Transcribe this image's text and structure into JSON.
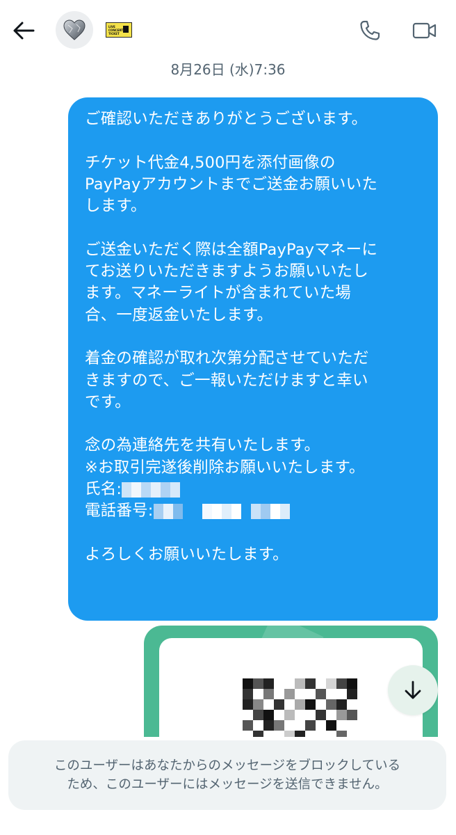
{
  "header": {
    "back_icon": "arrow-left-icon",
    "avatar_icon": "heart-icon",
    "badge": {
      "line1": "LIVE",
      "line2": "CONCERT",
      "line3": "TICKET"
    },
    "call_icon": "phone-icon",
    "video_icon": "video-camera-icon"
  },
  "timestamp": "8月26日 (水)7:36",
  "message": {
    "p1": "ご確認いただきありがとうございます。",
    "p2_l1": "チケット代金4,500円を添付画像の",
    "p2_l2": "PayPayアカウントまでご送金お願いいた",
    "p2_l3": "します。",
    "p3_l1": "ご送金いただく際は全額PayPayマネーに",
    "p3_l2": "てお送りいただきますようお願いいたし",
    "p3_l3": "ます。マネーライトが含まれていた場",
    "p3_l4": "合、一度返金いたします。",
    "p4_l1": "着金の確認が取れ次第分配させていただ",
    "p4_l2": "きますので、ご一報いただけますと幸い",
    "p4_l3": "です。",
    "p5_l1": "念の為連絡先を共有いたします。",
    "p5_l2": "※お取引完遂後削除お願いいたします。",
    "name_label": "氏名:",
    "phone_label": "電話番号:",
    "p6": "よろしくお願いいたします。"
  },
  "attachment": {
    "type": "image",
    "description_icon": "qr-code-icon"
  },
  "scroll_down_icon": "arrow-down-icon",
  "blocked_notice": {
    "line1": "このユーザーはあなたからのメッセージをブロックしている",
    "line2": "ため、このユーザーにはメッセージを送信できません。"
  },
  "colors": {
    "bubble": "#1d9bf0",
    "card": "#4bb993",
    "muted_text": "#536471",
    "notice_bg": "#eff3f4"
  }
}
